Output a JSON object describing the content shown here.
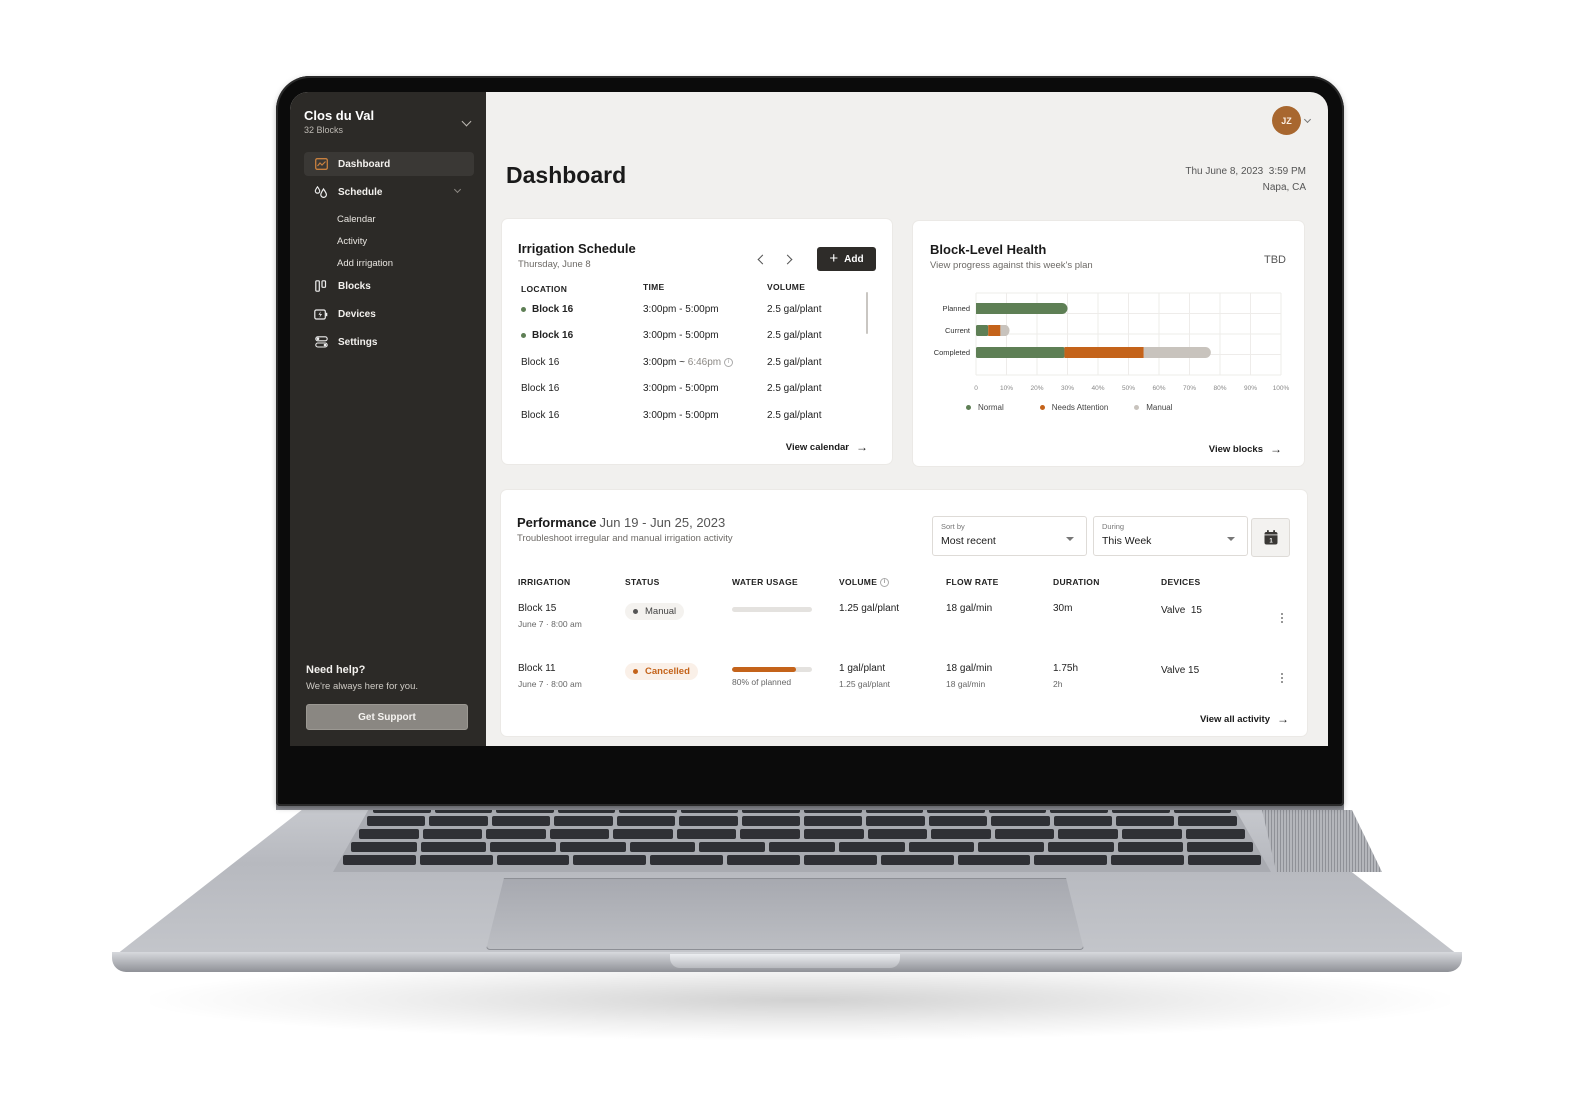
{
  "sidebar": {
    "org_name": "Clos du Val",
    "org_sub": "32 Blocks",
    "items": [
      {
        "label": "Dashboard",
        "icon": "chart-icon",
        "active": true
      },
      {
        "label": "Schedule",
        "icon": "droplets-icon",
        "expanded": true,
        "children": [
          "Calendar",
          "Activity",
          "Add irrigation"
        ]
      },
      {
        "label": "Blocks",
        "icon": "blocks-icon"
      },
      {
        "label": "Devices",
        "icon": "battery-bolt-icon"
      },
      {
        "label": "Settings",
        "icon": "toggles-icon"
      }
    ],
    "help_title": "Need help?",
    "help_sub": "We're always here for you.",
    "support_label": "Get Support"
  },
  "header": {
    "title": "Dashboard",
    "datetime": "Thu June 8, 2023  3:59 PM",
    "location": "Napa, CA",
    "avatar_initials": "JZ"
  },
  "schedule": {
    "title": "Irrigation Schedule",
    "date": "Thursday, June 8",
    "add_label": "Add",
    "columns": [
      "LOCATION",
      "TIME",
      "VOLUME"
    ],
    "rows": [
      {
        "location": "Block 16",
        "active": true,
        "time": "3:00pm - 5:00pm",
        "volume": "2.5 gal/plant"
      },
      {
        "location": "Block 16",
        "active": true,
        "time": "3:00pm - 5:00pm",
        "volume": "2.5 gal/plant"
      },
      {
        "location": "Block 16",
        "active": false,
        "time_start": "3:00pm ~ ",
        "time_end": "6:46pm",
        "estimated": true,
        "volume": "2.5 gal/plant"
      },
      {
        "location": "Block 16",
        "active": false,
        "time": "3:00pm - 5:00pm",
        "volume": "2.5 gal/plant"
      },
      {
        "location": "Block 16",
        "active": false,
        "time": "3:00pm - 5:00pm",
        "volume": "2.5 gal/plant"
      }
    ],
    "view_link": "View calendar"
  },
  "health": {
    "title": "Block-Level Health",
    "subtitle": "View progress against this week's plan",
    "badge": "TBD",
    "view_link": "View blocks"
  },
  "chart_data": {
    "type": "bar",
    "orientation": "horizontal",
    "stacked": true,
    "categories": [
      "Planned",
      "Current",
      "Completed"
    ],
    "series": [
      {
        "name": "Normal",
        "color": "#5e7f55",
        "values": [
          30,
          4,
          29
        ]
      },
      {
        "name": "Needs Attention",
        "color": "#c4631a",
        "values": [
          0,
          4,
          26
        ]
      },
      {
        "name": "Manual",
        "color": "#c8c3bd",
        "values": [
          0,
          3,
          22
        ]
      }
    ],
    "xlim": [
      0,
      100
    ],
    "xticks": [
      "0",
      "10%",
      "20%",
      "30%",
      "40%",
      "50%",
      "60%",
      "70%",
      "80%",
      "90%",
      "100%"
    ],
    "grid": true,
    "legend": "bottom-left"
  },
  "performance": {
    "title": "Performance",
    "range": "Jun 19 - Jun 25, 2023",
    "subtitle": "Troubleshoot irregular and manual irrigation activity",
    "sort_label": "Sort by",
    "sort_value": "Most recent",
    "during_label": "During",
    "during_value": "This Week",
    "columns": [
      "IRRIGATION",
      "STATUS",
      "WATER USAGE",
      "VOLUME",
      "FLOW RATE",
      "DURATION",
      "DEVICES"
    ],
    "rows": [
      {
        "name": "Block 15",
        "when": "June 7 · 8:00 am",
        "status": "Manual",
        "status_color": "#555555",
        "usage_pct": 0,
        "usage_note": "",
        "volume": "1.25 gal/plant",
        "volume_planned": "",
        "flow": "18 gal/min",
        "flow_planned": "",
        "duration": "30m",
        "duration_planned": "",
        "device": "Valve  15"
      },
      {
        "name": "Block 11",
        "when": "June 7 · 8:00 am",
        "status": "Cancelled",
        "status_color": "#c4631a",
        "usage_pct": 80,
        "usage_note": "80% of planned",
        "volume": "1 gal/plant",
        "volume_planned": "1.25 gal/plant",
        "flow": "18 gal/min",
        "flow_planned": "18 gal/min",
        "duration": "1.75h",
        "duration_planned": "2h",
        "device": "Valve 15"
      }
    ],
    "view_link": "View all activity"
  },
  "colors": {
    "normal": "#5e7f55",
    "attention": "#c4631a",
    "manual": "#c8c3bd",
    "sidebar_bg": "#2c2a27",
    "avatar": "#a8672f"
  }
}
